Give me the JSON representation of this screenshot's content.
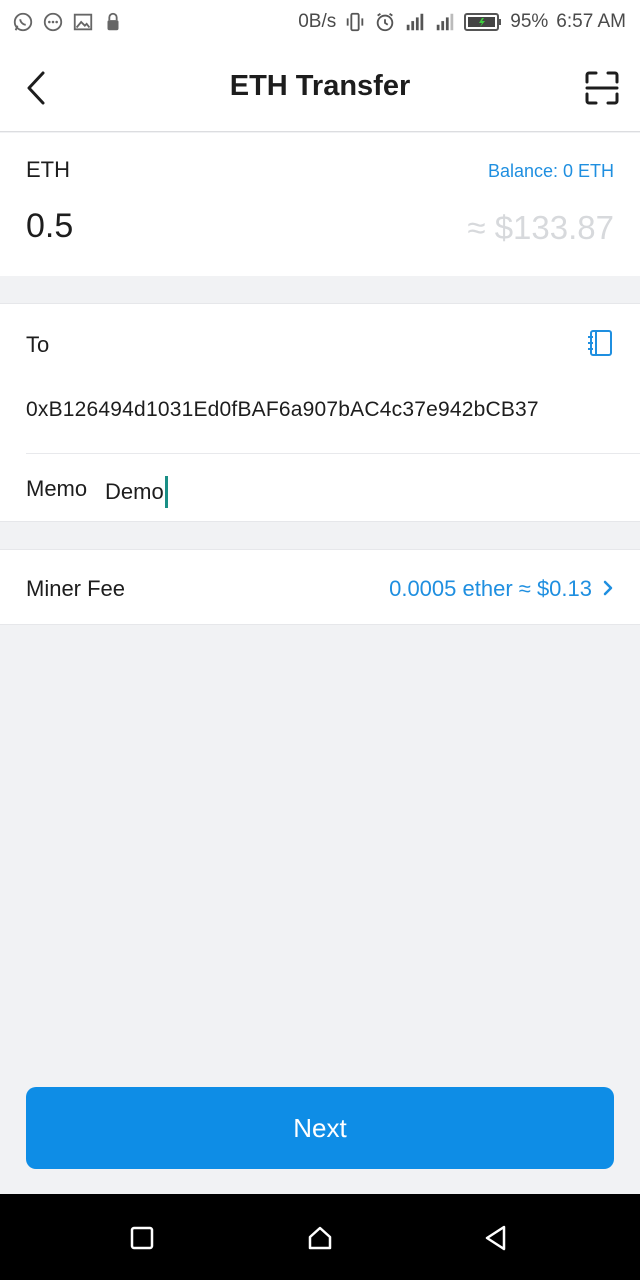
{
  "status_bar": {
    "speed": "0B/s",
    "battery": "95%",
    "time": "6:57 AM",
    "icons": [
      "whatsapp-icon",
      "chat-icon",
      "image-icon",
      "lock-icon",
      "vibrate-icon",
      "alarm-icon",
      "signal-icon",
      "signal-icon-2",
      "battery-icon"
    ]
  },
  "header": {
    "title": "ETH Transfer",
    "back_icon": "chevron-left-icon",
    "scan_icon": "scan-icon"
  },
  "amount": {
    "asset": "ETH",
    "balance": "Balance: 0 ETH",
    "value": "0.5",
    "fiat": "≈ $133.87"
  },
  "recipient": {
    "to_label": "To",
    "address": "0xB126494d1031Ed0fBAF6a907bAC4c37e942bCB37",
    "address_book_icon": "address-book-icon",
    "memo_label": "Memo",
    "memo_value": "Demo"
  },
  "fee": {
    "label": "Miner Fee",
    "value": "0.0005 ether ≈ $0.13"
  },
  "actions": {
    "next": "Next"
  },
  "colors": {
    "accent": "#0e8de6",
    "link": "#1f8fe0",
    "background": "#f1f2f4",
    "caret": "#1a8f86"
  }
}
